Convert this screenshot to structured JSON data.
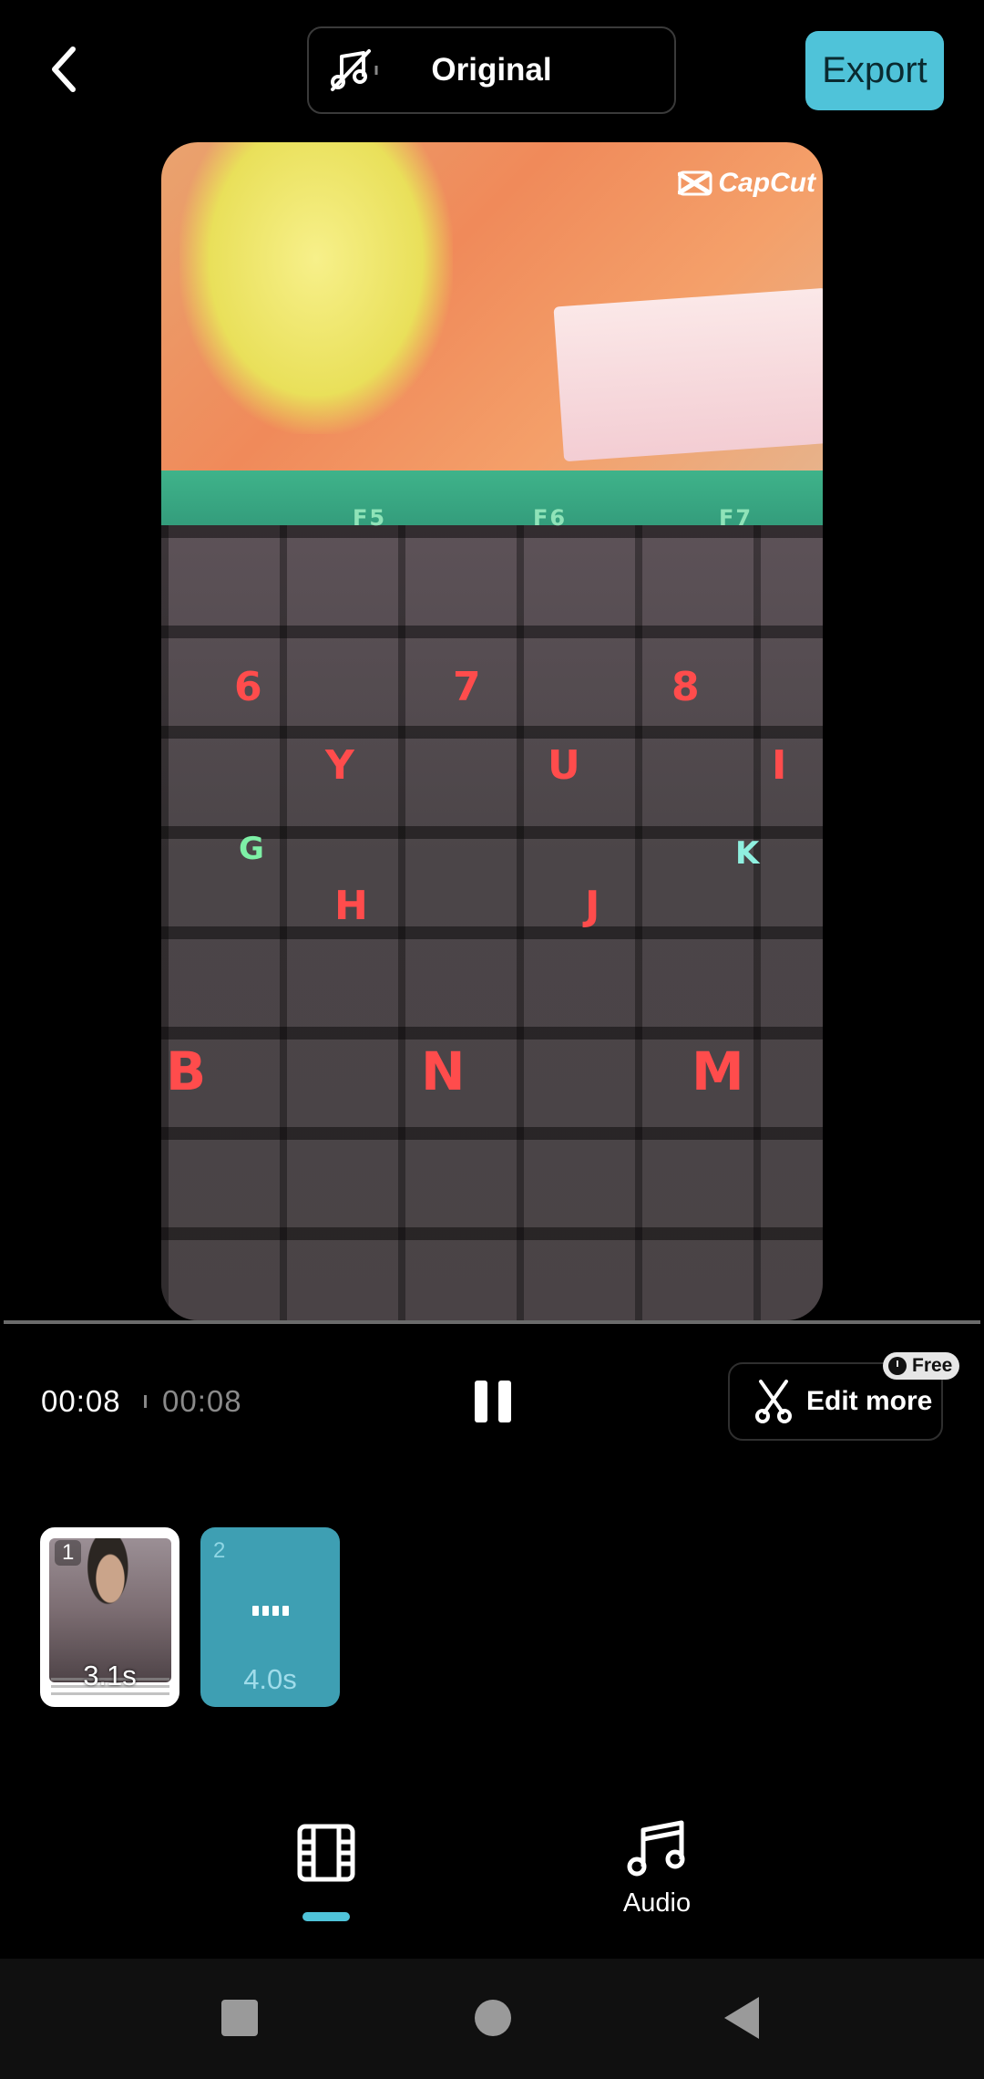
{
  "header": {
    "audio_mode_label": "Original",
    "export_label": "Export"
  },
  "preview": {
    "watermark_text": "CapCut",
    "keys": [
      "F5",
      "F6",
      "F7",
      "6",
      "7",
      "8",
      "Y",
      "U",
      "I",
      "G",
      "H",
      "J",
      "K",
      "B",
      "N",
      "M"
    ]
  },
  "playback": {
    "current_time": "00:08",
    "total_time": "00:08"
  },
  "edit_more": {
    "label": "Edit more",
    "badge": "Free"
  },
  "clips": [
    {
      "index": "1",
      "duration": "3.1s"
    },
    {
      "index": "2",
      "duration": "4.0s"
    }
  ],
  "tabs": {
    "audio_label": "Audio"
  },
  "colors": {
    "accent": "#4fc3d9",
    "background": "#000000"
  }
}
